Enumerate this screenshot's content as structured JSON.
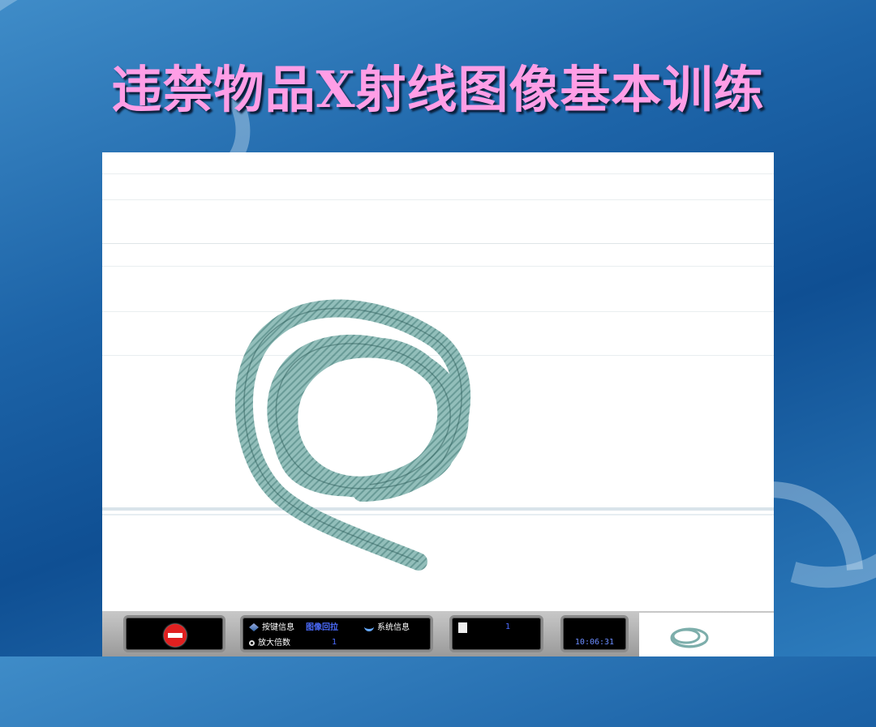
{
  "title": "违禁物品X射线图像基本训练",
  "xray_image": {
    "subject": "coiled flexible hose"
  },
  "statusbar": {
    "stop_icon": "stop-icon",
    "key_info_label": "按键信息",
    "key_info_value": "图像回拉",
    "system_info_label": "系统信息",
    "zoom_label": "放大倍数",
    "zoom_value": "1",
    "page_value": "1",
    "clock": "10:06:31"
  },
  "colors": {
    "title": "#ff9ee6",
    "background": "#1d64a8",
    "hose": "#6fa6a2",
    "stop_button": "#e02020",
    "status_value": "#4c6cff"
  }
}
